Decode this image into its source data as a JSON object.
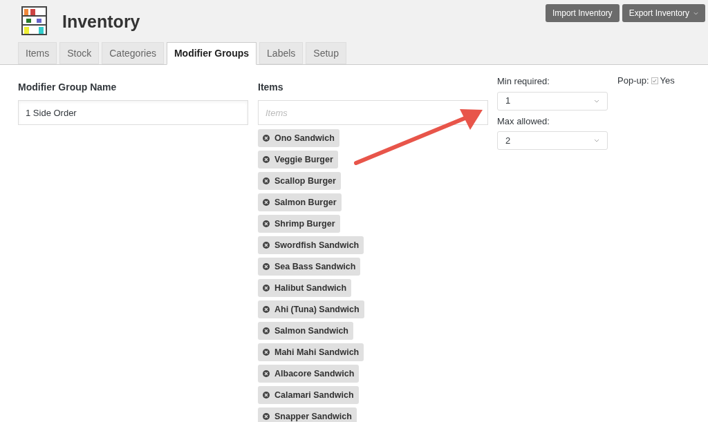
{
  "header": {
    "title": "Inventory",
    "buttons": [
      {
        "label": "Import Inventory",
        "kind": "plain"
      },
      {
        "label": "Export Inventory",
        "kind": "dropdown"
      }
    ]
  },
  "tabs": [
    {
      "label": "Items",
      "selected": false
    },
    {
      "label": "Stock",
      "selected": false
    },
    {
      "label": "Categories",
      "selected": false
    },
    {
      "label": "Modifier Groups",
      "selected": true
    },
    {
      "label": "Labels",
      "selected": false
    },
    {
      "label": "Setup",
      "selected": false
    }
  ],
  "form": {
    "name_label": "Modifier Group Name",
    "name_value": "1 Side Order",
    "items_label": "Items",
    "items_placeholder": "Items",
    "items": [
      "Ono Sandwich",
      "Veggie Burger",
      "Scallop Burger",
      "Salmon Burger",
      "Shrimp Burger",
      "Swordfish Sandwich",
      "Sea Bass Sandwich",
      "Halibut Sandwich",
      "Ahi (Tuna) Sandwich",
      "Salmon Sandwich",
      "Mahi Mahi Sandwich",
      "Albacore Sandwich",
      "Calamari Sandwich",
      "Snapper Sandwich"
    ],
    "min_label": "Min required:",
    "min_value": "1",
    "max_label": "Max allowed:",
    "max_value": "2",
    "popup_label": "Pop-up:",
    "popup_checked": true,
    "popup_text": "Yes"
  }
}
